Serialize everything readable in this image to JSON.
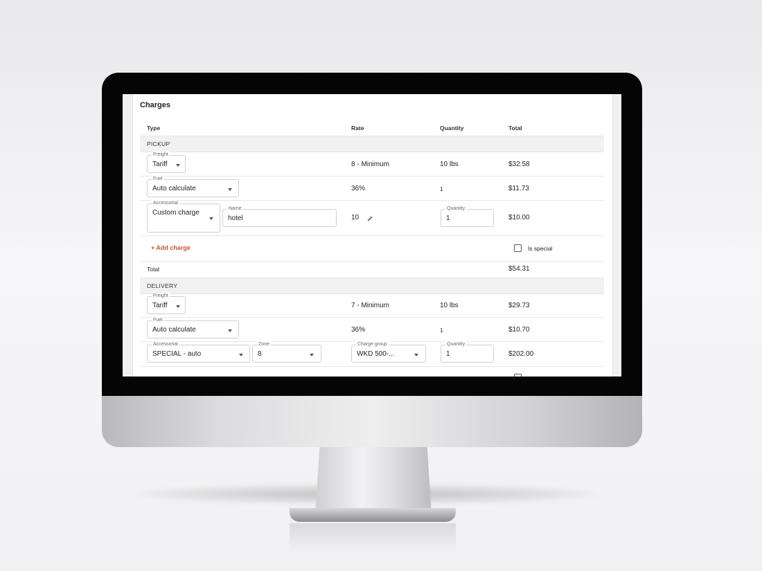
{
  "charges": {
    "title": "Charges",
    "columns": {
      "type": "Type",
      "rate": "Rate",
      "quantity": "Quantity",
      "total": "Total"
    },
    "pickup": {
      "label": "PICKUP",
      "freight": {
        "label": "Freight",
        "value": "Tariff",
        "rate": "8 - Minimum",
        "quantity": "10 lbs",
        "total": "$32.58"
      },
      "fuel": {
        "label": "Fuel",
        "value": "Auto calculate",
        "rate": "36%",
        "quantity": "1",
        "total": "$11.73"
      },
      "accessorial": {
        "label": "Accessorial",
        "value": "Custom charge",
        "name_label": "Name",
        "name_value": "hotel",
        "rate": "10",
        "quantity_label": "Quantity",
        "quantity_value": "1",
        "total": "$10.00"
      },
      "add_charge": "+ Add charge",
      "is_special": "Is special",
      "total_label": "Total",
      "total_value": "$54.31"
    },
    "delivery": {
      "label": "DELIVERY",
      "freight": {
        "label": "Freight",
        "value": "Tariff",
        "rate": "7 - Minimum",
        "quantity": "10 lbs",
        "total": "$29.73"
      },
      "fuel": {
        "label": "Fuel",
        "value": "Auto calculate",
        "rate": "36%",
        "quantity": "1",
        "total": "$10.70"
      },
      "accessorial": {
        "label": "Accessorial",
        "value": "SPECIAL - auto",
        "zone_label": "Zone",
        "zone_value": "8",
        "charge_group_label": "Charge group",
        "charge_group_value": "WKD 500-...",
        "quantity_label": "Quantity",
        "quantity_value": "1",
        "total": "$202.00"
      }
    }
  },
  "colors": {
    "accent": "#c8553d",
    "bezel": "#050505",
    "band": "#f1f1f1"
  }
}
